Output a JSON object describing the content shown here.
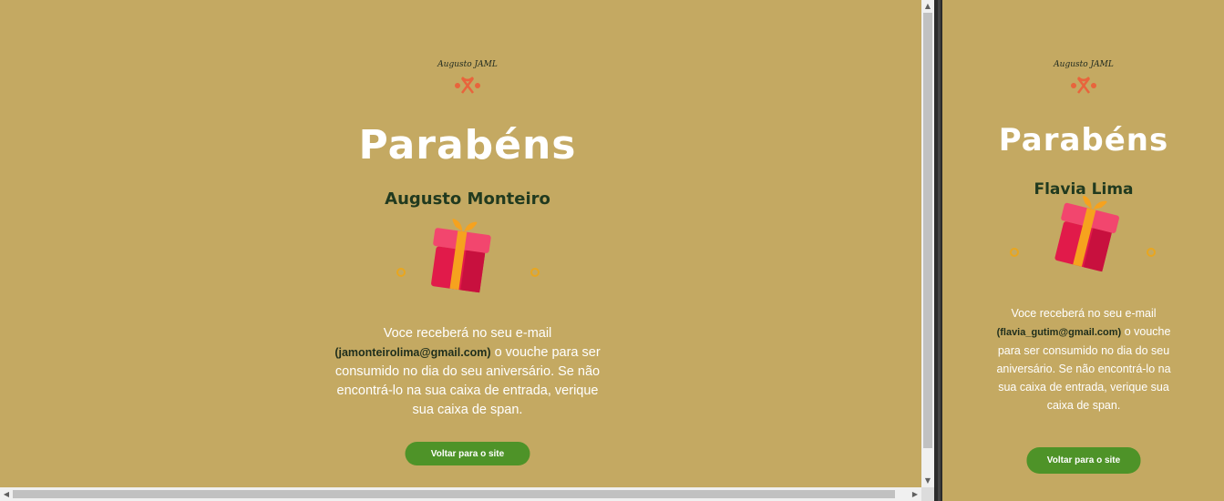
{
  "desktop": {
    "brand": "Augusto JAML",
    "title": "Parabéns",
    "recipient": "Augusto Monteiro",
    "message_before": "Voce receberá no seu e-mail",
    "email": "(jamonteirolima@gmail.com)",
    "message_after": "o vouche para ser consumido no dia do seu aniversário. Se não encontrá-lo na sua caixa de entrada, verique sua caixa de span.",
    "button": "Voltar para o site"
  },
  "mobile": {
    "brand": "Augusto JAML",
    "title": "Parabéns",
    "recipient": "Flavia Lima",
    "message_before": "Voce receberá no seu e-mail",
    "email": "(flavia_gutim@gmail.com)",
    "message_after": "o vouche para ser consumido no dia do seu aniversário. Se não encontrá-lo na sua caixa de entrada, verique sua caixa de span.",
    "button": "Voltar para o site"
  },
  "colors": {
    "background": "#c4a962",
    "button": "#4e9328",
    "title": "#ffffff",
    "name": "#213a1f",
    "logo": "#e8643c"
  },
  "icons": [
    "brand-logo-icon",
    "gift-icon",
    "confetti-dot-icon",
    "scroll-arrow-up-icon",
    "scroll-arrow-down-icon",
    "scroll-arrow-left-icon",
    "scroll-arrow-right-icon"
  ]
}
